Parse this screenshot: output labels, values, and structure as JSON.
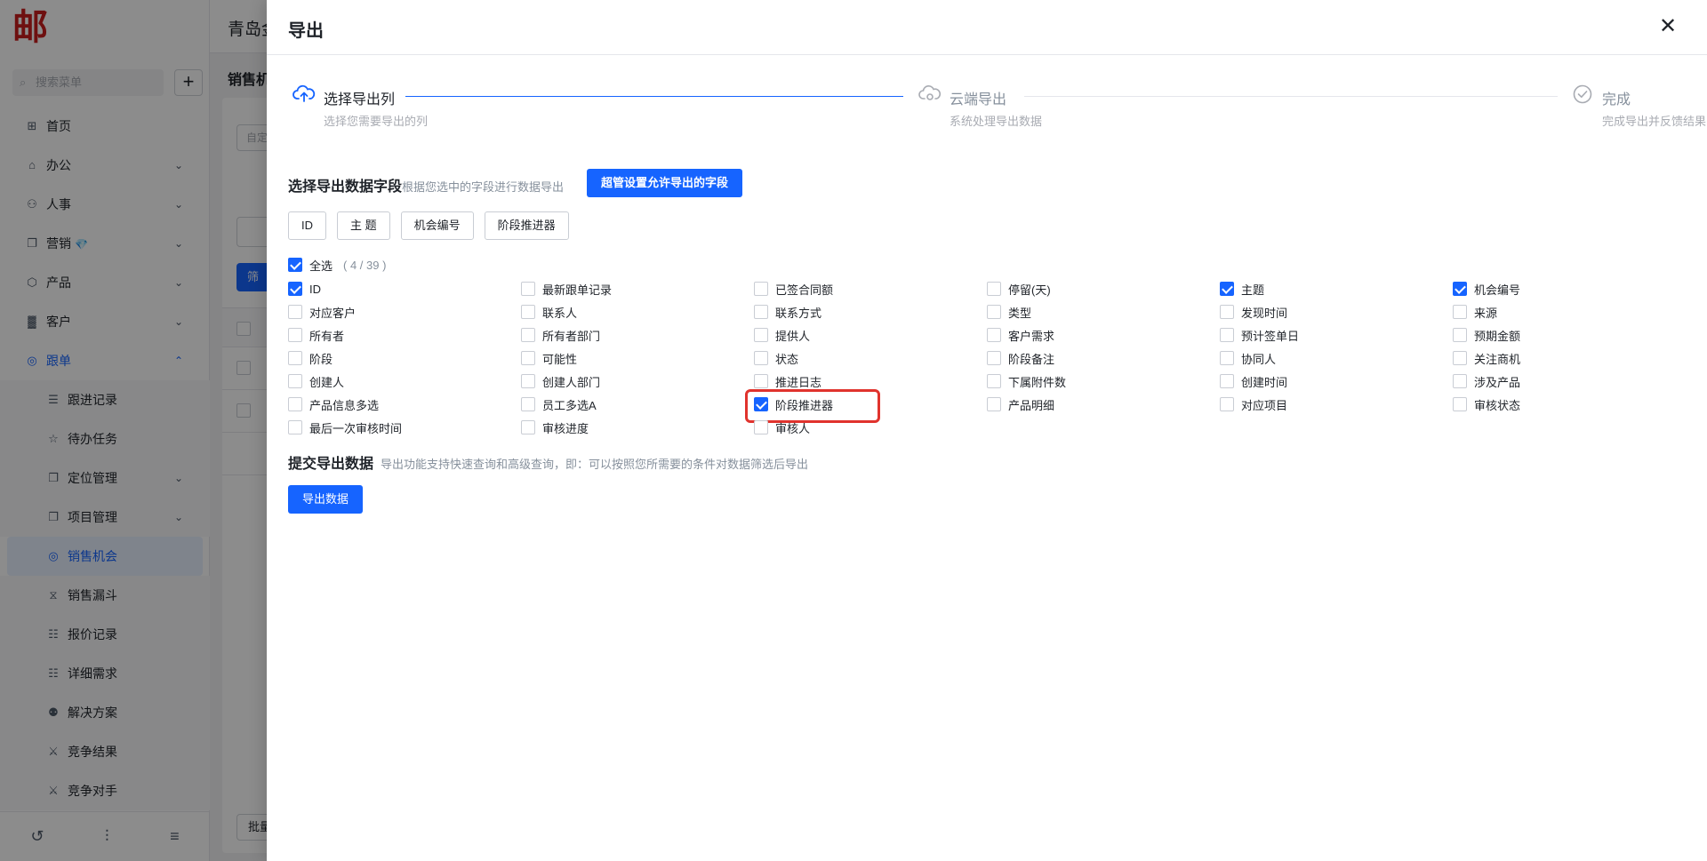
{
  "app": {
    "logo_text": "邮",
    "company_name": "青岛金",
    "search_placeholder": "搜索菜单",
    "add_icon": "plus-icon"
  },
  "sidebar": {
    "items": [
      {
        "label": "首页",
        "icon": "home-icon",
        "has_arrow": false
      },
      {
        "label": "办公",
        "icon": "office-icon",
        "has_arrow": true
      },
      {
        "label": "人事",
        "icon": "people-icon",
        "has_arrow": true
      },
      {
        "label": "营销",
        "icon": "marketing-icon",
        "has_arrow": true,
        "badge": "💎"
      },
      {
        "label": "产品",
        "icon": "product-icon",
        "has_arrow": true
      },
      {
        "label": "客户",
        "icon": "customer-icon",
        "has_arrow": true
      },
      {
        "label": "跟单",
        "icon": "follow-icon",
        "has_arrow": true,
        "open": true
      }
    ],
    "sub_items": [
      {
        "label": "跟进记录",
        "icon": "record-icon",
        "has_arrow": false
      },
      {
        "label": "待办任务",
        "icon": "pin-icon",
        "has_arrow": false
      },
      {
        "label": "定位管理",
        "icon": "location-icon",
        "has_arrow": true
      },
      {
        "label": "项目管理",
        "icon": "project-icon",
        "has_arrow": true
      },
      {
        "label": "销售机会",
        "icon": "target-icon",
        "has_arrow": false,
        "active": true
      },
      {
        "label": "销售漏斗",
        "icon": "funnel-icon",
        "has_arrow": false
      },
      {
        "label": "报价记录",
        "icon": "quote-icon",
        "has_arrow": false
      },
      {
        "label": "详细需求",
        "icon": "requirement-icon",
        "has_arrow": false
      },
      {
        "label": "解决方案",
        "icon": "solution-icon",
        "has_arrow": false
      },
      {
        "label": "竞争结果",
        "icon": "competition-icon",
        "has_arrow": false
      },
      {
        "label": "竞争对手",
        "icon": "rival-icon",
        "has_arrow": false
      }
    ]
  },
  "background": {
    "page_title": "销售机",
    "input_placeholder": "自定",
    "filter_button": "筛",
    "batch_button": "批量"
  },
  "drawer": {
    "title": "导出",
    "close_icon": "close-icon",
    "steps": [
      {
        "title": "选择导出列",
        "desc": "选择您需要导出的列",
        "icon": "cloud-upload-icon",
        "status": "active"
      },
      {
        "title": "云端导出",
        "desc": "系统处理导出数据",
        "icon": "cloud-process-icon",
        "status": "pending"
      },
      {
        "title": "完成",
        "desc": "完成导出并反馈结果",
        "icon": "check-circle-icon",
        "status": "pending"
      }
    ],
    "field_section": {
      "title": "选择导出数据字段",
      "hint": "根据您选中的字段进行数据导出",
      "admin_button": "超管设置允许导出的字段"
    },
    "selected_tags": [
      "ID",
      "主 题",
      "机会编号",
      "阶段推进器"
    ],
    "select_all": {
      "label": "全选",
      "count": "( 4 / 39 )",
      "checked": true
    },
    "fields": [
      {
        "label": "ID",
        "checked": true
      },
      {
        "label": "最新跟单记录",
        "checked": false
      },
      {
        "label": "已签合同额",
        "checked": false
      },
      {
        "label": "停留(天)",
        "checked": false
      },
      {
        "label": "主题",
        "checked": true
      },
      {
        "label": "机会编号",
        "checked": true
      },
      {
        "label": "对应客户",
        "checked": false
      },
      {
        "label": "联系人",
        "checked": false
      },
      {
        "label": "联系方式",
        "checked": false
      },
      {
        "label": "类型",
        "checked": false
      },
      {
        "label": "发现时间",
        "checked": false
      },
      {
        "label": "来源",
        "checked": false
      },
      {
        "label": "所有者",
        "checked": false
      },
      {
        "label": "所有者部门",
        "checked": false
      },
      {
        "label": "提供人",
        "checked": false
      },
      {
        "label": "客户需求",
        "checked": false
      },
      {
        "label": "预计签单日",
        "checked": false
      },
      {
        "label": "预期金额",
        "checked": false
      },
      {
        "label": "阶段",
        "checked": false
      },
      {
        "label": "可能性",
        "checked": false
      },
      {
        "label": "状态",
        "checked": false
      },
      {
        "label": "阶段备注",
        "checked": false
      },
      {
        "label": "协同人",
        "checked": false
      },
      {
        "label": "关注商机",
        "checked": false
      },
      {
        "label": "创建人",
        "checked": false
      },
      {
        "label": "创建人部门",
        "checked": false
      },
      {
        "label": "推进日志",
        "checked": false
      },
      {
        "label": "下属附件数",
        "checked": false
      },
      {
        "label": "创建时间",
        "checked": false
      },
      {
        "label": "涉及产品",
        "checked": false
      },
      {
        "label": "产品信息多选",
        "checked": false
      },
      {
        "label": "员工多选A",
        "checked": false
      },
      {
        "label": "阶段推进器",
        "checked": true,
        "highlight": true
      },
      {
        "label": "产品明细",
        "checked": false
      },
      {
        "label": "对应项目",
        "checked": false
      },
      {
        "label": "审核状态",
        "checked": false
      },
      {
        "label": "最后一次审核时间",
        "checked": false
      },
      {
        "label": "审核进度",
        "checked": false
      },
      {
        "label": "审核人",
        "checked": false
      }
    ],
    "submit_section": {
      "title": "提交导出数据",
      "hint": "导出功能支持快速查询和高级查询，即：可以按照您所需要的条件对数据筛选后导出",
      "export_button": "导出数据"
    },
    "highlight_color": "#e0332d",
    "accent_color": "#1664ff"
  }
}
